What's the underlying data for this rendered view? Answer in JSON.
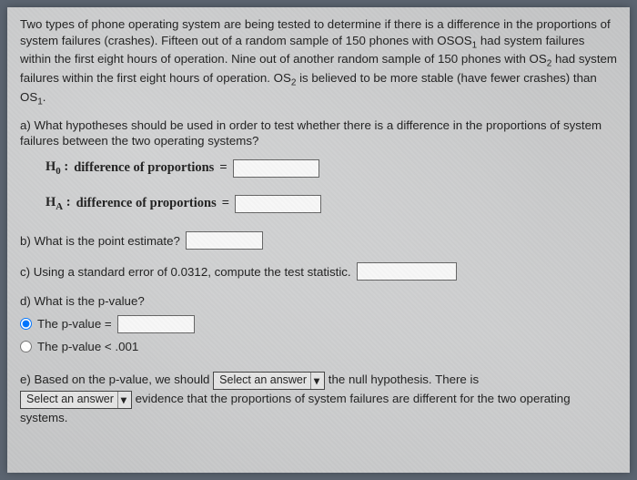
{
  "intro": {
    "p1a": "Two types of phone operating system are being tested to determine if there is a difference in the proportions of system failures (crashes). Fifteen out of a random sample of 150 phones with OS",
    "p1sub1": "1",
    "p1b": " had system failures within the first eight hours of operation. Nine out of another random sample of 150 phones with OS",
    "p1sub2": "2",
    "p1c": " had system failures within the first eight hours of operation. OS",
    "p1sub3": "2",
    "p1d": " is believed to be more stable (have fewer crashes) than OS",
    "p1sub4": "1",
    "p1e": "."
  },
  "a": {
    "question": "a) What hypotheses should be used in order to test whether there is a difference in the proportions of system failures between the two operating systems?",
    "h0_label": "H",
    "h0_sub": "0",
    "ha_label": "H",
    "ha_sub": "A",
    "colon": " : ",
    "phrase": "difference of proportions",
    "equals": "="
  },
  "b": {
    "text": "b) What is the point estimate?"
  },
  "c": {
    "text": "c) Using a standard error of 0.0312, compute the test statistic."
  },
  "d": {
    "text": "d) What is the p-value?",
    "opt1_before": "The p-value =",
    "opt2": "The p-value < .001"
  },
  "e": {
    "t1": "e) Based on the p-value, we should ",
    "select_label": "Select an answer",
    "t2": " the null hypothesis. There is",
    "t3": " evidence that the proportions of system failures are different for the two operating systems."
  }
}
